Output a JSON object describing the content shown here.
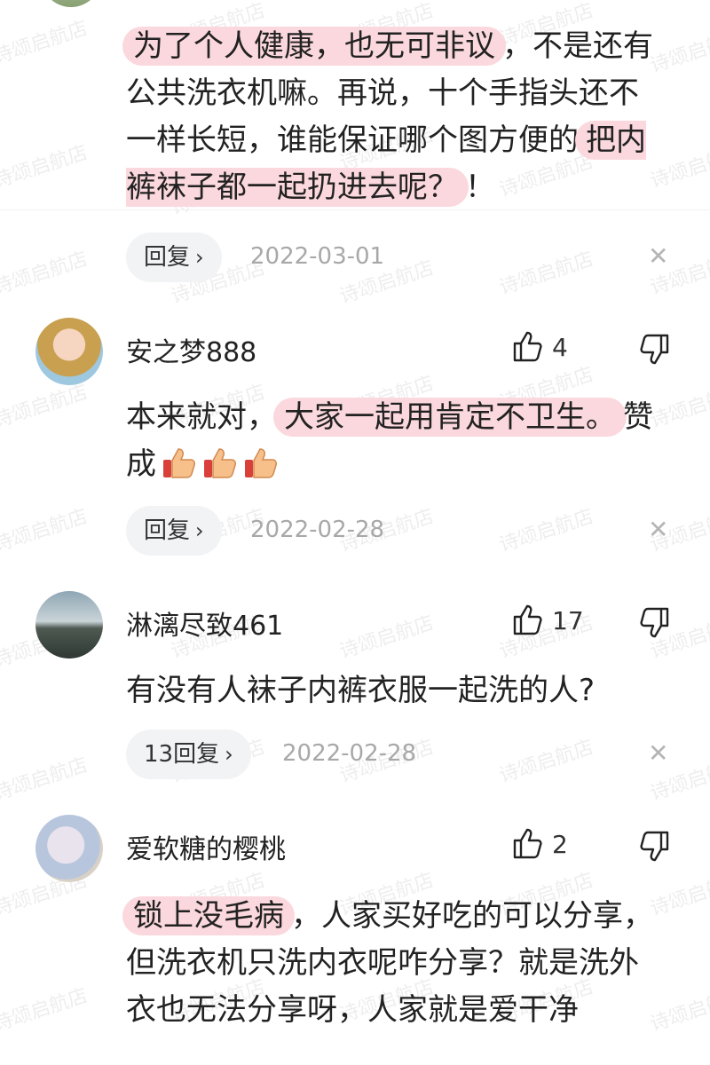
{
  "comments": [
    {
      "text_parts": [
        {
          "t": "为了个人健康，也无可非议",
          "hl": true
        },
        {
          "t": "，不是还有公共洗衣机嘛。再说，十个手指头还不一样长短，谁能保证哪个图方便的",
          "hl": false
        },
        {
          "t": "把内裤袜子都一起扔进去呢？",
          "hl": true
        },
        {
          "t": "！",
          "hl": false
        }
      ],
      "reply_label": "回复",
      "date": "2022-03-01"
    },
    {
      "username": "安之梦888",
      "likes": "4",
      "text_parts": [
        {
          "t": "本来就对，",
          "hl": false
        },
        {
          "t": "大家一起用肯定不卫生。",
          "hl": true
        },
        {
          "t": "赞成",
          "hl": false
        }
      ],
      "emoji": [
        "thumbs-up-emoji",
        "thumbs-up-emoji",
        "thumbs-up-emoji"
      ],
      "reply_label": "回复",
      "date": "2022-02-28"
    },
    {
      "username": "淋漓尽致461",
      "likes": "17",
      "text_parts": [
        {
          "t": "有没有人袜子内裤衣服一起洗的人?",
          "hl": false
        }
      ],
      "reply_label": "13回复",
      "date": "2022-02-28"
    },
    {
      "username": "爱软糖的樱桃",
      "likes": "2",
      "text_parts": [
        {
          "t": "锁上没毛病",
          "hl": true
        },
        {
          "t": "，人家买好吃的可以分享，但洗衣机只洗内衣呢咋分享？就是洗外衣也无法分享呀，人家就是爱干净",
          "hl": false
        }
      ]
    }
  ],
  "watermark": "诗颂启航店",
  "colors": {
    "highlight": "#fbd8dd",
    "reply_bg": "#f2f3f5",
    "date": "#a8a8a8"
  }
}
